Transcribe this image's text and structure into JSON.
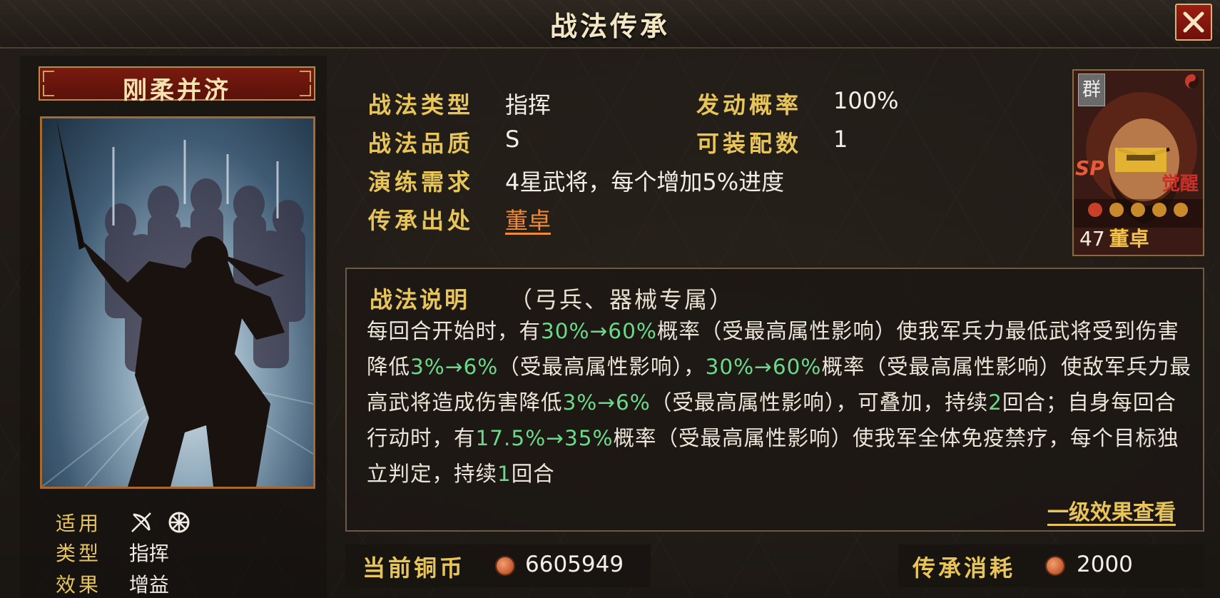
{
  "window": {
    "title": "战法传承"
  },
  "skill": {
    "name": "刚柔并济",
    "meta": [
      {
        "key": "适用",
        "value": ""
      },
      {
        "key": "类型",
        "value": "指挥"
      },
      {
        "key": "效果",
        "value": "增益"
      }
    ],
    "suitable_icons": [
      "bow-icon",
      "siege-wheel-icon"
    ]
  },
  "attributes": {
    "type_label": "战法类型",
    "type_value": "指挥",
    "rate_label": "发动概率",
    "rate_value": "100%",
    "quality_label": "战法品质",
    "quality_value": "S",
    "slots_label": "可装配数",
    "slots_value": "1",
    "practice_label": "演练需求",
    "practice_value": "4星武将，每个增加5%进度",
    "source_label": "传承出处",
    "source_value": "董卓"
  },
  "hero": {
    "faction": "群",
    "tag": "SP",
    "awaken": "觉醒",
    "level": "47",
    "name": "董卓",
    "stars_filled": 1,
    "stars_total": 5
  },
  "description": {
    "title": "战法说明",
    "subtitle": "（弓兵、器械专属）",
    "segments": [
      [
        "每回合开始时，有",
        ""
      ],
      [
        "30%→60%",
        "g"
      ],
      [
        "概率（受最高属性影响）使我军兵力最低武将受到伤害降低",
        ""
      ],
      [
        "3%→6%",
        "g"
      ],
      [
        "（受最高属性影响），",
        ""
      ],
      [
        "30%→60%",
        "g"
      ],
      [
        "概率（受最高属性影响）使敌军兵力最高武将造成伤害降低",
        ""
      ],
      [
        "3%→6%",
        "g"
      ],
      [
        "（受最高属性影响），可叠加，持续",
        ""
      ],
      [
        "2",
        "g"
      ],
      [
        "回合；自身每回合行动时，有",
        ""
      ],
      [
        "17.5%→35%",
        "g"
      ],
      [
        "概率（受最高属性影响）使我军全体免疫禁疗，每个目标独立判定，持续",
        ""
      ],
      [
        "1",
        "g"
      ],
      [
        "回合",
        ""
      ]
    ],
    "effect_link": "一级效果查看"
  },
  "currency": {
    "current_label": "当前铜币",
    "current_value": "6605949",
    "cost_label": "传承消耗",
    "cost_value": "2000",
    "coin_color": "#c85a30"
  },
  "colors": {
    "gold": "#e8c55a",
    "green": "#6cd98a",
    "orange": "#f08a36",
    "red": "#7a1a10"
  }
}
